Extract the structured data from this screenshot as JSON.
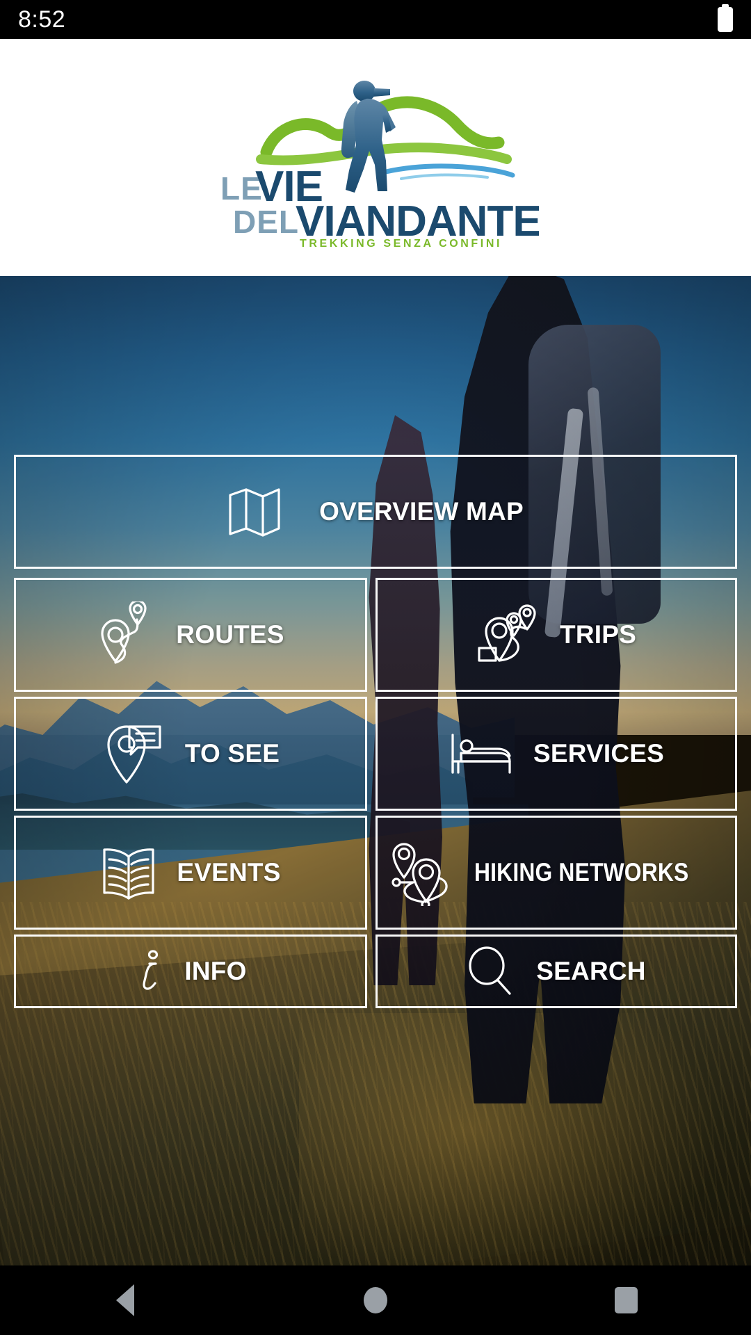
{
  "status_bar": {
    "time": "8:52",
    "battery_icon": "battery-full-icon"
  },
  "header": {
    "logo": {
      "line1_light": "LE",
      "line1_bold": "VIE",
      "line2_light": "DEL",
      "line2_bold": "VIANDANTE",
      "tagline": "TREKKING SENZA CONFINI",
      "colors": {
        "light_blue": "#7e9fb5",
        "dark_navy": "#1b4a6e",
        "green": "#7ab929",
        "stream_blue": "#4aa3d8"
      },
      "mark": "hiker-silhouette"
    }
  },
  "menu": {
    "tiles": [
      {
        "id": "overview-map",
        "label": "OVERVIEW MAP",
        "icon": "folded-map-icon"
      },
      {
        "id": "routes",
        "label": "ROUTES",
        "icon": "route-pins-icon"
      },
      {
        "id": "trips",
        "label": "TRIPS",
        "icon": "trip-pins-icon"
      },
      {
        "id": "to-see",
        "label": "TO SEE",
        "icon": "pin-speech-bubble-icon"
      },
      {
        "id": "services",
        "label": "SERVICES",
        "icon": "bed-icon"
      },
      {
        "id": "events",
        "label": "EVENTS",
        "icon": "open-book-icon"
      },
      {
        "id": "hiking-networks",
        "label": "HIKING NETWORKS",
        "icon": "network-pins-icon"
      },
      {
        "id": "info",
        "label": "INFO",
        "icon": "info-italic-i-icon"
      },
      {
        "id": "search",
        "label": "SEARCH",
        "icon": "magnifier-icon"
      }
    ]
  },
  "nav_bar": {
    "back_label": "Back",
    "home_label": "Home",
    "recents_label": "Recents"
  }
}
